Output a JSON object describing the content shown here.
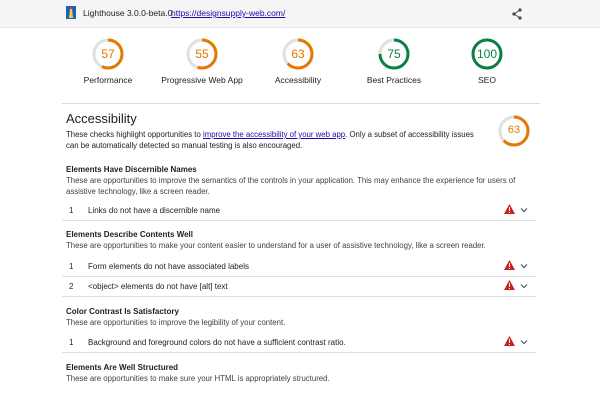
{
  "topbar": {
    "version": "Lighthouse 3.0.0-beta.0",
    "url": "https://designsupply-web.com/"
  },
  "gauges": [
    {
      "label": "Performance",
      "score": "57",
      "fraction": 0.57,
      "color": "#e67700"
    },
    {
      "label": "Progressive Web App",
      "score": "55",
      "fraction": 0.55,
      "color": "#e67700"
    },
    {
      "label": "Accessibility",
      "score": "63",
      "fraction": 0.63,
      "color": "#e67700"
    },
    {
      "label": "Best Practices",
      "score": "75",
      "fraction": 0.75,
      "color": "#0b8043"
    },
    {
      "label": "SEO",
      "score": "100",
      "fraction": 1.0,
      "color": "#0b8043"
    }
  ],
  "section": {
    "title": "Accessibility",
    "desc_before": "These checks highlight opportunities to ",
    "desc_link": "improve the accessibility of your web app",
    "desc_after": ". Only a subset of accessibility issues can be automatically detected so manual testing is also encouraged.",
    "score": "63",
    "fraction": 0.63,
    "color": "#e67700"
  },
  "groups": [
    {
      "title": "Elements Have Discernible Names",
      "desc": "These are opportunities to improve the semantics of the controls in your application. This may enhance the experience for users of assistive technology, like a screen reader.",
      "audits": [
        {
          "index": "1",
          "text": "Links do not have a discernible name"
        }
      ]
    },
    {
      "title": "Elements Describe Contents Well",
      "desc": "These are opportunities to make your content easier to understand for a user of assistive technology, like a screen reader.",
      "audits": [
        {
          "index": "1",
          "text": "Form elements do not have associated labels"
        },
        {
          "index": "2",
          "text": "<object> elements do not have [alt] text"
        }
      ]
    },
    {
      "title": "Color Contrast Is Satisfactory",
      "desc": "These are opportunities to improve the legibility of your content.",
      "audits": [
        {
          "index": "1",
          "text": "Background and foreground colors do not have a sufficient contrast ratio."
        }
      ]
    },
    {
      "title": "Elements Are Well Structured",
      "desc": "These are opportunities to make sure your HTML is appropriately structured.",
      "audits": []
    }
  ],
  "colors": {
    "fail": "#c7221f",
    "average": "#e67700",
    "pass": "#0b8043",
    "link": "#1a0dab"
  }
}
